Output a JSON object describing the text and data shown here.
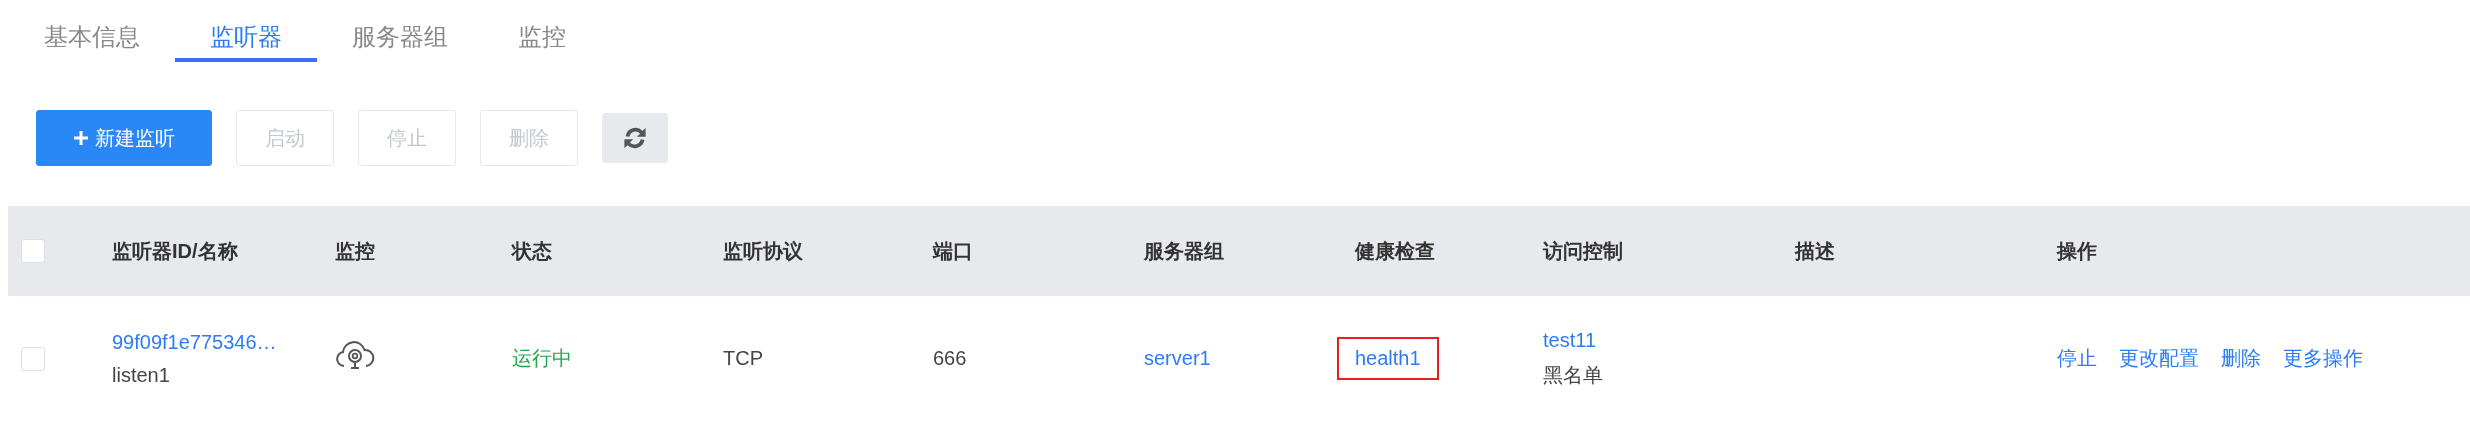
{
  "tabs": [
    {
      "label": "基本信息",
      "selected": false
    },
    {
      "label": "监听器",
      "selected": true
    },
    {
      "label": "服务器组",
      "selected": false
    },
    {
      "label": "监控",
      "selected": false
    }
  ],
  "toolbar": {
    "buttons": [
      {
        "label": "新建监听",
        "kind": "primary",
        "disabled": false
      },
      {
        "label": "启动",
        "kind": "plain",
        "disabled": true
      },
      {
        "label": "停止",
        "kind": "plain",
        "disabled": true
      },
      {
        "label": "删除",
        "kind": "plain",
        "disabled": true
      },
      {
        "kind": "refresh",
        "disabled": false
      }
    ]
  },
  "table": {
    "all_checked": false,
    "columns": [
      "监听器ID/名称",
      "监控",
      "状态",
      "监听协议",
      "端口",
      "服务器组",
      "健康检查",
      "访问控制",
      "描述",
      "操作"
    ],
    "rows": [
      {
        "checked": false,
        "id": "99f09f1e775346…",
        "name": "listen1",
        "status": "运行中",
        "running": true,
        "protocol": "TCP",
        "port": "666",
        "server_group": "server1",
        "health_check": {
          "text": "health1",
          "highlighted": true
        },
        "access_control": "test11",
        "access_type": "黑名单",
        "actions": [
          "停止",
          "更改配置",
          "删除",
          "更多操作"
        ]
      }
    ]
  }
}
